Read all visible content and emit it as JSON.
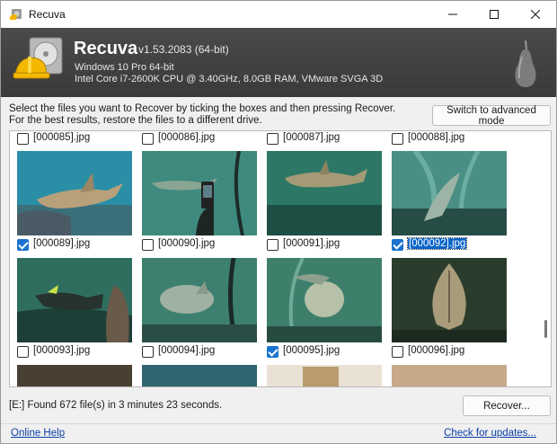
{
  "window": {
    "title": "Recuva"
  },
  "header": {
    "app_name": "Recuva",
    "version": "v1.53.2083 (64-bit)",
    "os": "Windows 10 Pro 64-bit",
    "hardware": "Intel Core i7-2600K CPU @ 3.40GHz, 8.0GB RAM, VMware SVGA 3D"
  },
  "instructions": {
    "line1": "Select the files you want to Recover by ticking the boxes and then pressing Recover.",
    "line2": "For the best results, restore the files to a different drive."
  },
  "toolbar": {
    "advanced_label": "Switch to advanced mode"
  },
  "files": [
    {
      "name": "[000085].jpg",
      "checked": false
    },
    {
      "name": "[000086].jpg",
      "checked": false
    },
    {
      "name": "[000087].jpg",
      "checked": false
    },
    {
      "name": "[000088].jpg",
      "checked": false
    },
    {
      "name": "[000089].jpg",
      "checked": true
    },
    {
      "name": "[000090].jpg",
      "checked": false
    },
    {
      "name": "[000091].jpg",
      "checked": false
    },
    {
      "name": "[000092].jpg",
      "checked": true,
      "selected": true
    },
    {
      "name": "[000093].jpg",
      "checked": false
    },
    {
      "name": "[000094].jpg",
      "checked": false
    },
    {
      "name": "[000095].jpg",
      "checked": true
    },
    {
      "name": "[000096].jpg",
      "checked": false
    }
  ],
  "status": {
    "text": "[E:] Found 672 file(s) in 3 minutes 23 seconds."
  },
  "actions": {
    "recover_label": "Recover..."
  },
  "footer": {
    "help_label": "Online Help",
    "updates_label": "Check for updates..."
  },
  "colors": {
    "header_bg": "#3f3f3f",
    "link": "#0b3fa8",
    "check": "#1a73d0",
    "selection": "#0a64c8"
  }
}
